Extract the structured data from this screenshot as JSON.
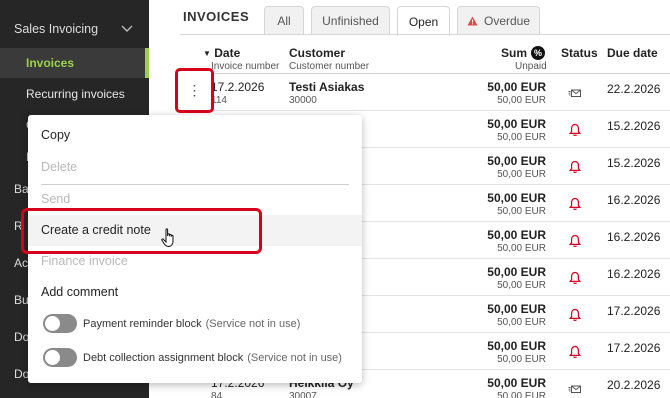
{
  "sidebar": {
    "group": "Sales Invoicing",
    "items": [
      {
        "label": "Invoices",
        "active": true
      },
      {
        "label": "Recurring invoices",
        "active": false
      }
    ],
    "fragments": [
      "C",
      "I",
      "Ba",
      "R",
      "Ac",
      "Bu",
      "Do",
      "Do"
    ]
  },
  "page": {
    "title": "INVOICES",
    "tabs": [
      {
        "label": "All",
        "active": false
      },
      {
        "label": "Unfinished",
        "active": false
      },
      {
        "label": "Open",
        "active": true
      },
      {
        "label": "Overdue",
        "active": false,
        "icon": "warning-icon"
      }
    ]
  },
  "table": {
    "headers": {
      "date": "Date",
      "date_sub": "Invoice number",
      "customer": "Customer",
      "customer_sub": "Customer number",
      "sum": "Sum",
      "sum_badge": "%",
      "sum_sub": "Unpaid",
      "status": "Status",
      "due": "Due date"
    },
    "rows": [
      {
        "date": "17.2.2026",
        "num": "114",
        "customer": "Testi Asiakas",
        "custnum": "30000",
        "sum": "50,00 EUR",
        "unpaid": "50,00 EUR",
        "status": "email-sent-icon",
        "due": "22.2.2026"
      },
      {
        "date": "",
        "num": "",
        "customer": "",
        "custnum": "",
        "sum": "50,00 EUR",
        "unpaid": "50,00 EUR",
        "status": "bell-icon",
        "due": "15.2.2026"
      },
      {
        "date": "",
        "num": "",
        "customer": "",
        "custnum": "",
        "sum": "50,00 EUR",
        "unpaid": "50,00 EUR",
        "status": "bell-icon",
        "due": "15.2.2026"
      },
      {
        "date": "",
        "num": "",
        "customer": "",
        "custnum": "",
        "sum": "50,00 EUR",
        "unpaid": "50,00 EUR",
        "status": "bell-icon",
        "due": "16.2.2026"
      },
      {
        "date": "",
        "num": "",
        "customer": "",
        "custnum": "",
        "sum": "50,00 EUR",
        "unpaid": "50,00 EUR",
        "status": "bell-icon",
        "due": "16.2.2026"
      },
      {
        "date": "",
        "num": "",
        "customer": "",
        "custnum": "",
        "sum": "50,00 EUR",
        "unpaid": "50,00 EUR",
        "status": "bell-icon",
        "due": "16.2.2026"
      },
      {
        "date": "",
        "num": "",
        "customer": "",
        "custnum": "",
        "sum": "50,00 EUR",
        "unpaid": "50,00 EUR",
        "status": "bell-icon",
        "due": "17.2.2026"
      },
      {
        "date": "",
        "num": "",
        "customer": "",
        "custnum": "",
        "sum": "50,00 EUR",
        "unpaid": "50,00 EUR",
        "status": "bell-icon",
        "due": "17.2.2026"
      },
      {
        "date": "17.2.2026",
        "num": "84",
        "customer": "Heikkilä Oy",
        "custnum": "30007",
        "sum": "50,00 EUR",
        "unpaid": "50,00 EUR",
        "status": "email-sent-icon",
        "due": "20.2.2026"
      }
    ]
  },
  "menu": {
    "copy": "Copy",
    "delete": "Delete",
    "send": "Send",
    "credit_note": "Create a credit note",
    "finance": "Finance invoice",
    "add_comment": "Add comment",
    "reminder_block": "Payment reminder block",
    "reminder_note": "(Service not in use)",
    "collection_block": "Debt collection assignment block",
    "collection_note": "(Service not in use)"
  },
  "colors": {
    "accent": "#9bd24a",
    "highlight": "#d6001c",
    "sidebar_bg": "#262626"
  }
}
